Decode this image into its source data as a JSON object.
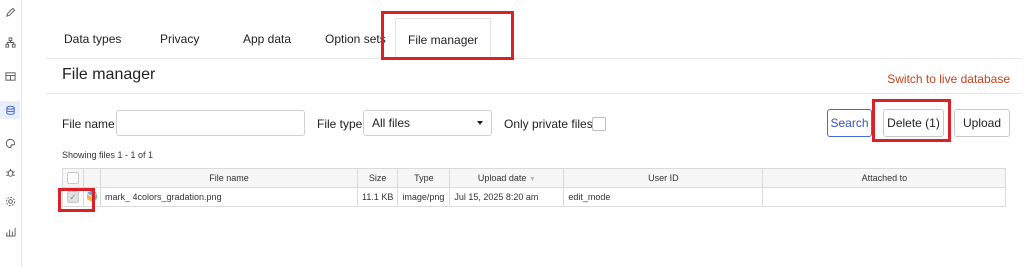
{
  "leftbar": {
    "icons": [
      "pencil-icon",
      "sitemap-icon",
      "layout-icon",
      "database-icon",
      "palette-icon",
      "bug-icon",
      "settings-icon",
      "analytics-icon"
    ],
    "active": "database-icon"
  },
  "tabs": [
    {
      "label": "Data types"
    },
    {
      "label": "Privacy"
    },
    {
      "label": "App data"
    },
    {
      "label": "Option sets"
    },
    {
      "label": "File manager"
    }
  ],
  "active_tab": "File manager",
  "page": {
    "title": "File manager",
    "switch_link": "Switch to live database"
  },
  "filters": {
    "file_name_label": "File name",
    "file_name_value": "",
    "file_type_label": "File type",
    "file_type_value": "All files",
    "private_label": "Only private files",
    "private_checked": false
  },
  "buttons": {
    "search": "Search",
    "delete": "Delete (1)",
    "upload": "Upload"
  },
  "showing": "Showing files 1 - 1 of 1",
  "table": {
    "columns": [
      "File name",
      "Size",
      "Type",
      "Upload date",
      "User ID",
      "Attached to"
    ],
    "sort_indicator": "▼",
    "rows": [
      {
        "checked": true,
        "file_name": "mark_ 4colors_gradation.png",
        "size": "11.1 KB",
        "type": "image/png",
        "upload_date": "Jul 15, 2025 8:20 am",
        "user_id": "edit_mode",
        "attached_to": ""
      }
    ]
  },
  "colors": {
    "highlight": "#dd1f26",
    "accent": "#3a53c4",
    "link": "#c4431f"
  }
}
